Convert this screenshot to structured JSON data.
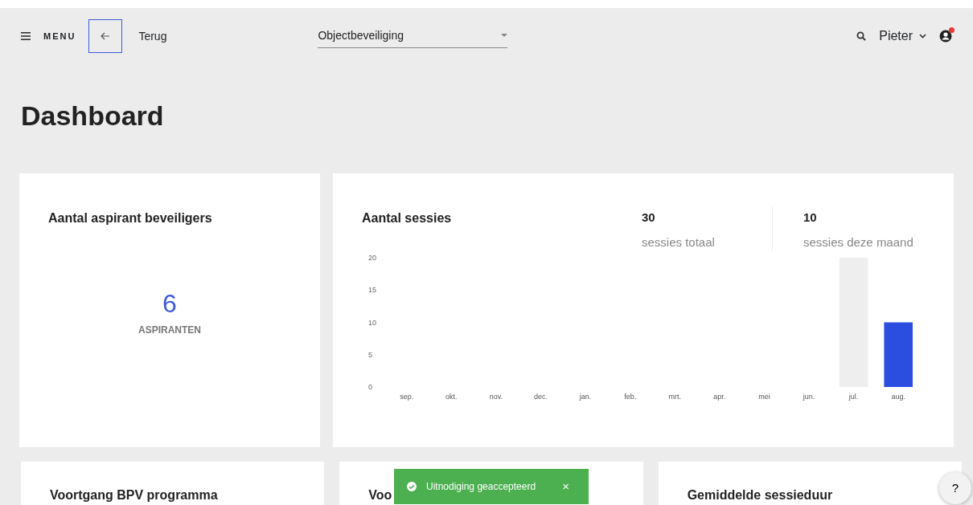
{
  "topbar": {
    "menu_label": "MENU",
    "back_label": "Terug",
    "select_value": "Objectbeveiliging",
    "user_name": "Pieter",
    "notification": true
  },
  "page_title": "Dashboard",
  "aspirants_card": {
    "title": "Aantal aspirant beveiligers",
    "count": "6",
    "count_label": "ASPIRANTEN"
  },
  "sessions_card": {
    "title": "Aantal sessies",
    "stats": [
      {
        "value": "30",
        "label": "sessies totaal"
      },
      {
        "value": "10",
        "label": "sessies deze maand"
      }
    ],
    "chart_data": {
      "type": "bar",
      "categories": [
        "sep.",
        "okt.",
        "nov.",
        "dec.",
        "jan.",
        "feb.",
        "mrt.",
        "apr.",
        "mei",
        "jun.",
        "jul.",
        "aug."
      ],
      "series": [
        {
          "color": "#eeeeee",
          "values": [
            0,
            0,
            0,
            0,
            0,
            0,
            0,
            0,
            0,
            0,
            20,
            null
          ]
        },
        {
          "color": "#2b4ee0",
          "values": [
            null,
            null,
            null,
            null,
            null,
            null,
            null,
            null,
            null,
            null,
            null,
            10
          ]
        }
      ],
      "ylim": [
        0,
        20
      ],
      "yticks": [
        0,
        5,
        10,
        15,
        20
      ]
    }
  },
  "bottom_cards": [
    {
      "title": "Voortgang BPV programma"
    },
    {
      "title": "Voo"
    },
    {
      "title": "Gemiddelde sessieduur"
    }
  ],
  "toast": {
    "text": "Uitnodiging geaccepteerd",
    "close": "×"
  },
  "help_button": "?"
}
